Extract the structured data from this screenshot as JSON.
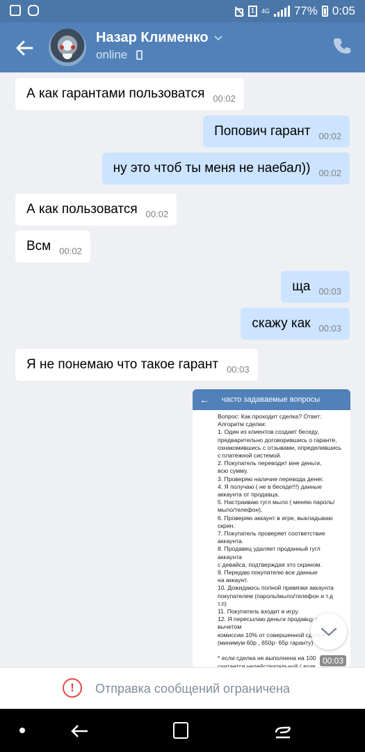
{
  "status_bar": {
    "battery": "77%",
    "time": "0:05",
    "network": "4G",
    "sim": "1"
  },
  "header": {
    "contact_name": "Назар Клименко",
    "status": "online"
  },
  "messages": [
    {
      "direction": "in",
      "text": "А как гарантами пользоватся",
      "time": "00:02"
    },
    {
      "direction": "out",
      "text": "Попович гарант",
      "time": "00:02"
    },
    {
      "direction": "out",
      "text": "ну это чтоб ты меня не наебал))",
      "time": "00:02"
    },
    {
      "direction": "in",
      "text": "А как пользоватся",
      "time": "00:02"
    },
    {
      "direction": "in",
      "text": "Всм",
      "time": "00:02"
    },
    {
      "direction": "out",
      "text": "ща",
      "time": "00:03"
    },
    {
      "direction": "out",
      "text": "скажу как",
      "time": "00:03"
    },
    {
      "direction": "in",
      "text": "Я не понемаю что такое гарант",
      "time": "00:03"
    }
  ],
  "image_message": {
    "time": "00:03",
    "screen_title": "часто задаваемые вопросы",
    "screen_text": "Вопрос: Как проходит сделка? Ответ:\nАлгоритм сделки:\n1. Один из клиентов создает беседу,\nпредварительно договорившись о гаранте,\nознакомившись с отзывами, определившись\nс платежной системой.\n2. Покупатель переводит мне деньги,\nвсю сумму.\n3. Проверяю наличие перевода денег.\n4. Я получаю ( не в беседе!!!) данные\nаккаунта от продавца.\n5. Настраиваю гугл мыло ( меняю пароль/\nмыло/телефон).\n6. Проверяю аккаунт в игре, выкладываю\nскрин.\n7. Покупатель проверяет соответствие\nаккаунта.\n8. Продавец удаляет проданный гугл аккаунта\nс девайса, подтверждая это скрином.\n9. Передаю покупателю все данные\nна аккаунт.\n10. Дожидаюсь полной привязки аккаунта\nпокупателем (пароль/мыло/телефон и т.д т.п)\n11. Покупатель входит в игру.\n12. Я пересылаю деньги продавцу с вычетом\nкомиссии 10% от совершенной сделки.\n(минимум 60р , 650р- 65р гаранту)\n\n* если сделка не выполнена на 100\nсчитается недействительной ( возв\nкаждой стороне по истечению не бол\nчасов с начала совершения сделки ( время\nвозврата зависит от фактора повлек\nсобой срыв сделки)"
  },
  "restriction": {
    "text": "Отправка сообщений ограничена",
    "icon": "!"
  },
  "colors": {
    "header": "#5181b8",
    "incoming_bubble": "#ffffff",
    "outgoing_bubble": "#cce4ff",
    "background": "#eef0f4",
    "warning": "#e64646"
  }
}
